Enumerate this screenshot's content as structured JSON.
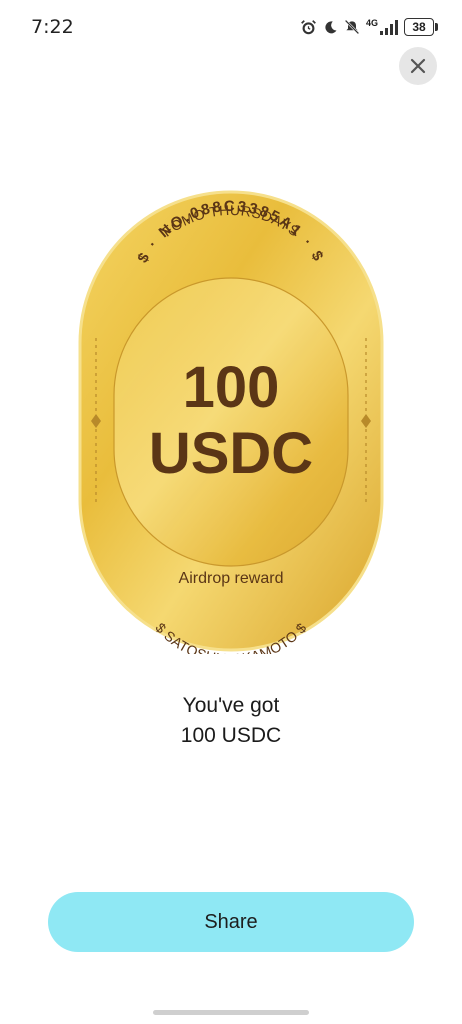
{
  "status_bar": {
    "time": "7:22",
    "network": "4G",
    "battery": "38",
    "icons": [
      "alarm-icon",
      "moon-icon",
      "mute-icon",
      "signal-icon",
      "battery-icon"
    ]
  },
  "close_icon": "close-icon",
  "coin": {
    "top_arc": "FOMO THURSDAYS",
    "serial": "$ · NO.088C3385A1 · $",
    "amount": "100",
    "currency": "USDC",
    "caption": "Airdrop reward",
    "bottom_arc": "$ SATOSHI NAKAMOTO $",
    "colors": {
      "gold": "#e6b93a",
      "rim": "#f2d066",
      "text": "#5b3616"
    }
  },
  "result": {
    "line1": "You've got",
    "line2": "100 USDC"
  },
  "share_button": {
    "label": "Share",
    "color": "#8fe8f4"
  }
}
